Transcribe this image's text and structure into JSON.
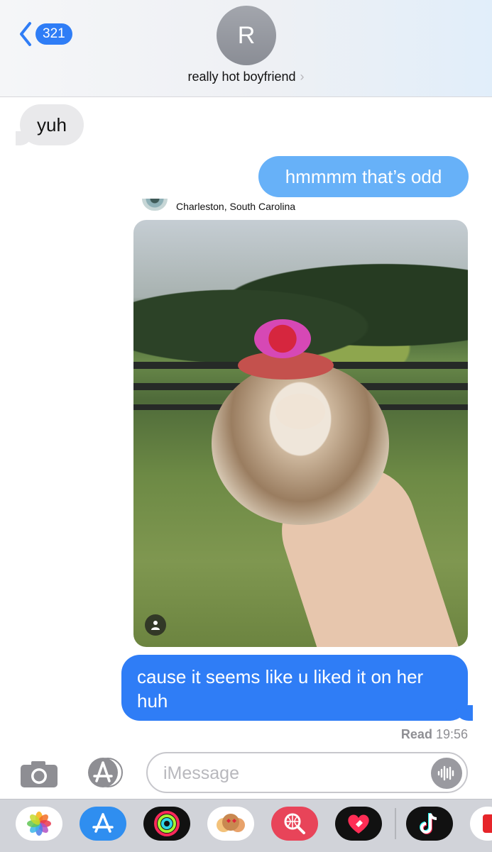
{
  "header": {
    "back_count": "321",
    "avatar_initial": "R",
    "contact_name": "really hot boyfriend",
    "contact_chevron": "›"
  },
  "messages": [
    {
      "direction": "received",
      "text": "yuh"
    },
    {
      "direction": "sent",
      "text": "hmmmm that’s odd"
    },
    {
      "direction": "sent",
      "type": "photo",
      "location": "Charleston, South Carolina",
      "photo_subject": "hedgehog"
    },
    {
      "direction": "sent",
      "text": "cause it seems like u liked it on her huh"
    }
  ],
  "receipt": {
    "status": "Read",
    "time": "19:56"
  },
  "compose": {
    "placeholder": "iMessage",
    "value": ""
  },
  "dock": {
    "apps": [
      "photos-icon",
      "app-store-icon",
      "activity-icon",
      "memoji-icon",
      "web-search-icon",
      "heart-app-icon",
      "tiktok-icon",
      "red-app-icon"
    ]
  },
  "colors": {
    "sent_bubble": "#2f7df6",
    "sent_bubble_light": "#67b1f8",
    "received_bubble": "#e9e9eb",
    "badge": "#2f7df6"
  }
}
